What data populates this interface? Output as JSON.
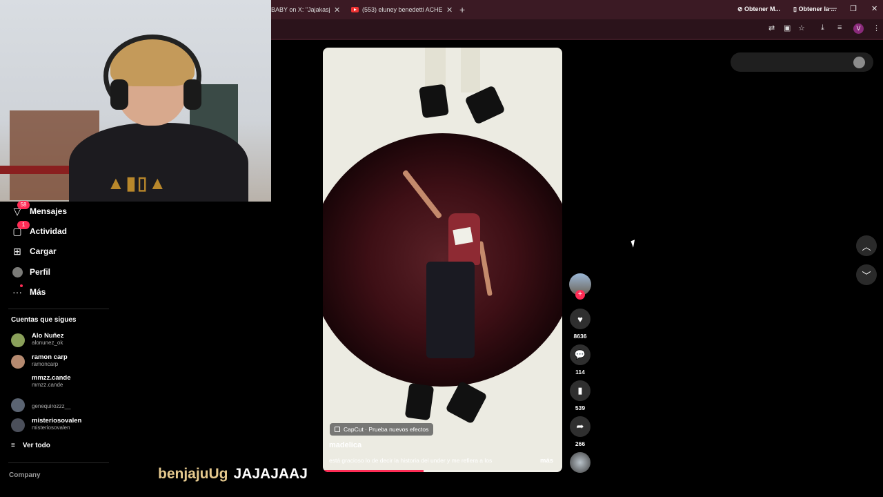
{
  "browser": {
    "tabs": [
      {
        "title": "BABY on X: \"Jajakasj am",
        "close": "✕"
      },
      {
        "title": "(553) eluney benedetti ACHE -",
        "close": "✕"
      }
    ],
    "new_tab": "+",
    "window_controls": {
      "minimize": "—",
      "restore": "❐",
      "close": "✕"
    },
    "profile_initial": "V"
  },
  "sidebar": {
    "items": [
      {
        "label": "Mensajes",
        "icon": "send-icon",
        "badge": "58"
      },
      {
        "label": "Actividad",
        "icon": "inbox-icon",
        "badge": "1"
      },
      {
        "label": "Cargar",
        "icon": "upload-icon"
      },
      {
        "label": "Perfil",
        "icon": "profile-avatar-icon"
      },
      {
        "label": "Más",
        "icon": "more-icon"
      }
    ],
    "following_header": "Cuentas que sigues",
    "accounts": [
      {
        "name": "Alo Nuñez",
        "handle": "alonunez_ok"
      },
      {
        "name": "ramon carp",
        "handle": "ramoncarp"
      },
      {
        "name": "mmzz.cande",
        "handle": "mmzz.cande"
      },
      {
        "name": "",
        "handle": "genequirozzz__"
      },
      {
        "name": "misteriosovalen",
        "handle": "misteriosovalen"
      }
    ],
    "see_all": "Ver todo",
    "company": "Company"
  },
  "chat": {
    "user": "benjajuUg",
    "message": "JAJAJAAJ"
  },
  "video": {
    "effect_tag": "CapCut · Prueba nuevos efectos",
    "author": "madelica",
    "caption": "está gracioso lo de decir la historia del under y me refiera a los",
    "more": "más",
    "progress": 0.42
  },
  "actions": {
    "likes": "8636",
    "comments": "114",
    "saves": "539",
    "shares": "266"
  },
  "top_actions": {
    "get_app_1": "Obtener M...",
    "get_app_2": "Obtener la ..."
  },
  "colors": {
    "accent": "#fe2c55",
    "chrome": "#3b1a24"
  }
}
